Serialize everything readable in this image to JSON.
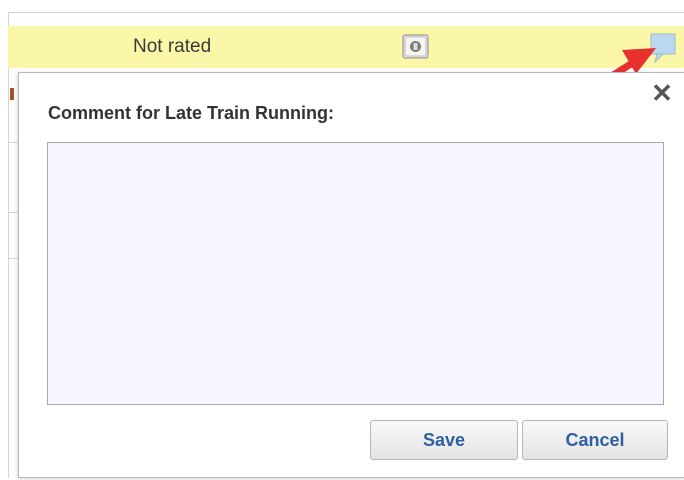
{
  "row": {
    "rating_text": "Not rated",
    "highlight_color": "#fbf7a8",
    "rate_icon": "rating-tag-icon",
    "comment_icon": "comment-bubble-icon"
  },
  "annotation": {
    "arrow_color": "#e8312f",
    "arrow_icon": "red-arrow-icon"
  },
  "dialog": {
    "title": "Comment for Late Train Running:",
    "close_label": "✕",
    "comment_value": "",
    "save_label": "Save",
    "cancel_label": "Cancel",
    "button_text_color": "#2f5fa0",
    "textarea_background": "#f6f6ff"
  }
}
